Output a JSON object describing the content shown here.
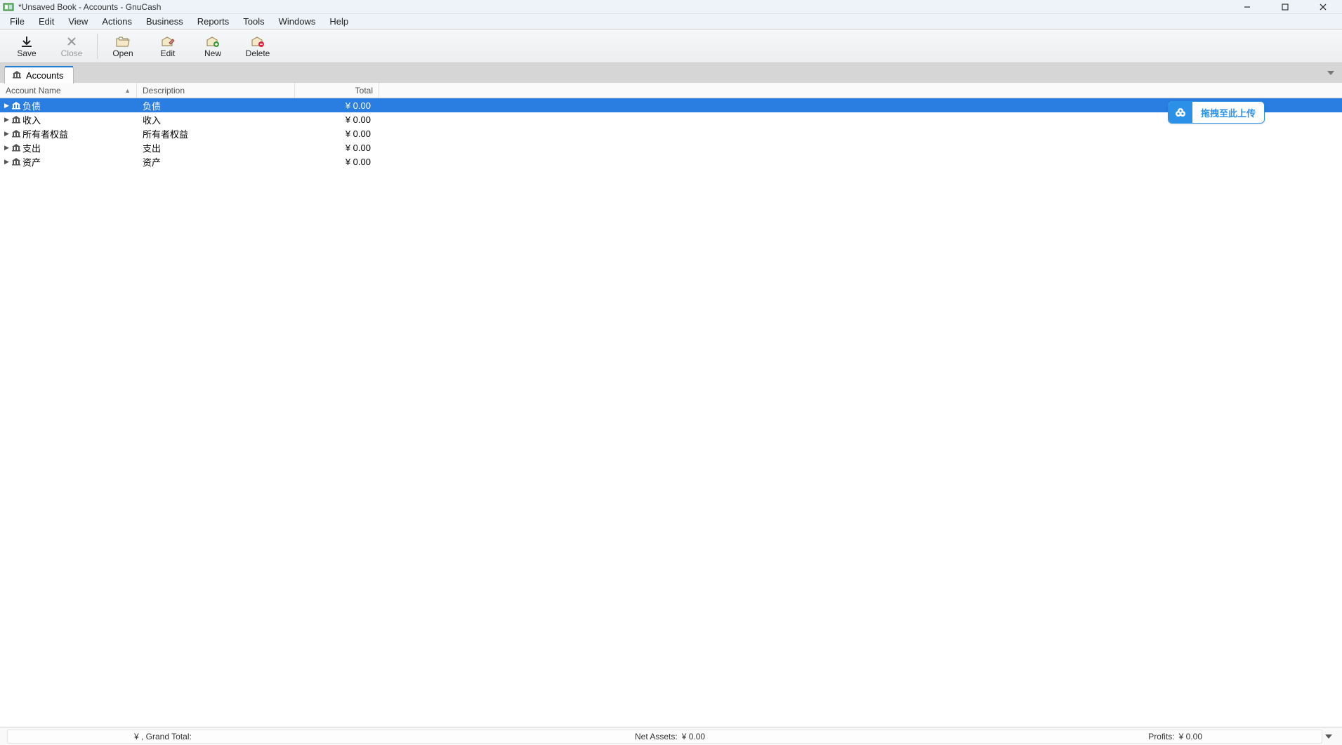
{
  "window": {
    "title": "*Unsaved Book - Accounts - GnuCash"
  },
  "menus": [
    "File",
    "Edit",
    "View",
    "Actions",
    "Business",
    "Reports",
    "Tools",
    "Windows",
    "Help"
  ],
  "toolbar": {
    "save": "Save",
    "close": "Close",
    "open": "Open",
    "edit": "Edit",
    "new": "New",
    "delete": "Delete"
  },
  "tab": {
    "label": "Accounts"
  },
  "upload": {
    "text": "拖拽至此上传"
  },
  "columns": {
    "name": "Account Name",
    "desc": "Description",
    "total": "Total"
  },
  "rows": [
    {
      "name": "负债",
      "desc": "负债",
      "total": "¥ 0.00",
      "selected": true
    },
    {
      "name": "收入",
      "desc": "收入",
      "total": "¥ 0.00",
      "selected": false
    },
    {
      "name": "所有者权益",
      "desc": "所有者权益",
      "total": "¥ 0.00",
      "selected": false
    },
    {
      "name": "支出",
      "desc": "支出",
      "total": "¥ 0.00",
      "selected": false
    },
    {
      "name": "资产",
      "desc": "资产",
      "total": "¥ 0.00",
      "selected": false
    }
  ],
  "status": {
    "grand_total_label": "¥ , Grand Total:",
    "net_assets_label": "Net Assets:",
    "net_assets_value": "¥ 0.00",
    "profits_label": "Profits:",
    "profits_value": "¥ 0.00"
  }
}
